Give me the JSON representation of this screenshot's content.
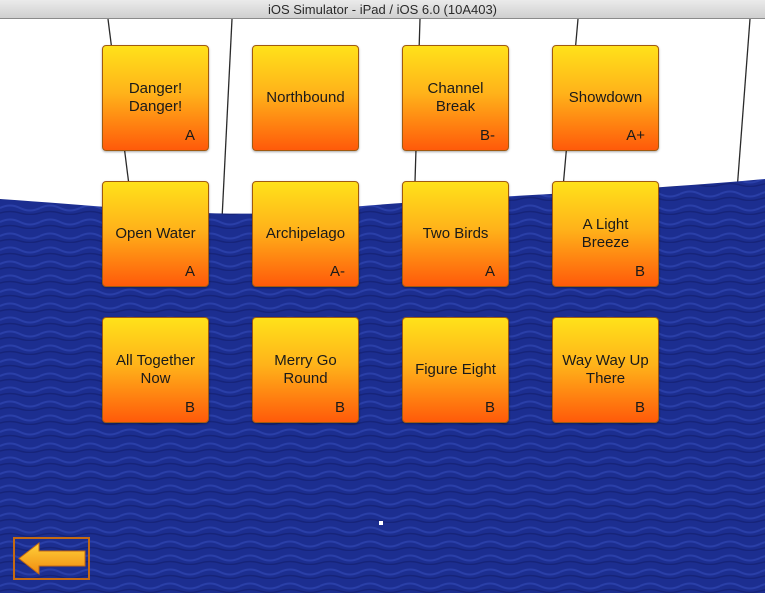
{
  "window": {
    "title": "iOS Simulator - iPad / iOS 6.0 (10A403)"
  },
  "colors": {
    "sky": "#ffffff",
    "sky_lines": "#222222",
    "water": "#1a2a8c",
    "tile_top": "#ffe21a",
    "tile_bottom": "#ff5a0a",
    "back_arrow": "#f39a1a"
  },
  "levels": [
    {
      "title": "Danger!\nDanger!",
      "grade": "A"
    },
    {
      "title": "Northbound",
      "grade": ""
    },
    {
      "title": "Channel\nBreak",
      "grade": "B-"
    },
    {
      "title": "Showdown",
      "grade": "A+"
    },
    {
      "title": "Open Water",
      "grade": "A"
    },
    {
      "title": "Archipelago",
      "grade": "A-"
    },
    {
      "title": "Two Birds",
      "grade": "A"
    },
    {
      "title": "A Light\nBreeze",
      "grade": "B"
    },
    {
      "title": "All Together\nNow",
      "grade": "B"
    },
    {
      "title": "Merry Go\nRound",
      "grade": "B"
    },
    {
      "title": "Figure Eight",
      "grade": "B"
    },
    {
      "title": "Way Way Up\nThere",
      "grade": "B"
    }
  ],
  "back_button": {
    "icon": "left-arrow-icon"
  }
}
